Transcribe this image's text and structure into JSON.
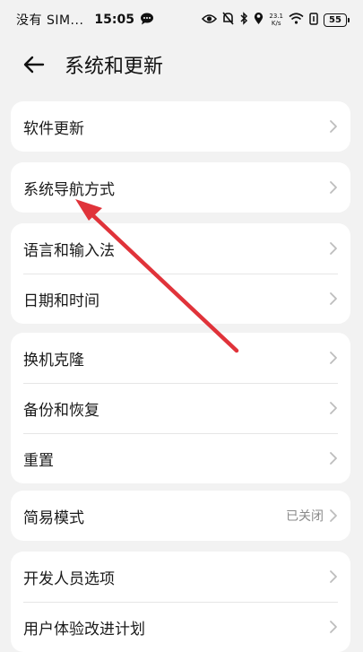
{
  "status_bar": {
    "carrier": "没有 SIM...",
    "time": "15:05",
    "net_speed_value": "23.1",
    "net_speed_unit": "K/s",
    "battery": "55",
    "icons": [
      "message-icon",
      "eye-icon",
      "silent-icon",
      "bluetooth-icon",
      "location-icon",
      "wifi-icon",
      "battery-icon"
    ]
  },
  "header": {
    "title": "系统和更新",
    "back_icon": "back-arrow-icon"
  },
  "groups": [
    {
      "items": [
        {
          "label": "软件更新"
        }
      ]
    },
    {
      "items": [
        {
          "label": "系统导航方式"
        }
      ]
    },
    {
      "items": [
        {
          "label": "语言和输入法"
        },
        {
          "label": "日期和时间"
        }
      ]
    },
    {
      "items": [
        {
          "label": "换机克隆"
        },
        {
          "label": "备份和恢复"
        },
        {
          "label": "重置"
        }
      ]
    },
    {
      "items": [
        {
          "label": "简易模式",
          "value": "已关闭"
        }
      ]
    },
    {
      "items": [
        {
          "label": "开发人员选项"
        },
        {
          "label": "用户体验改进计划"
        }
      ]
    }
  ],
  "colors": {
    "background": "#f2f2f2",
    "card": "#ffffff",
    "annotation_arrow": "#e0333a",
    "secondary_text": "#8a8a8a"
  }
}
